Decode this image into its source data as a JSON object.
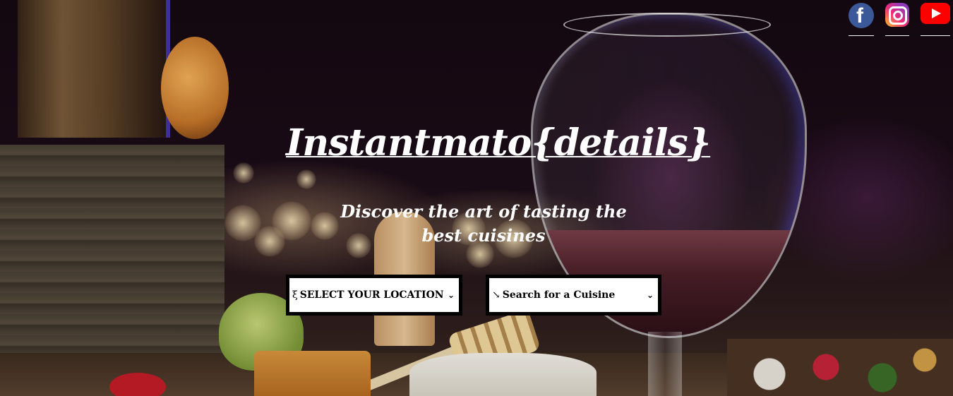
{
  "header": {
    "title": "Instantmato{details}",
    "tagline": "Discover the art of tasting the best cuisines"
  },
  "social": [
    {
      "name": "facebook-icon",
      "glyph": "f",
      "color": "#3b5998"
    },
    {
      "name": "instagram-icon",
      "color": "#e1306c"
    },
    {
      "name": "youtube-icon",
      "color": "#ff0000"
    }
  ],
  "search": {
    "location": {
      "icon": "location-pin-icon",
      "glyph": "ξ",
      "label": "SELECT YOUR LOCATION"
    },
    "cuisine": {
      "icon": "search-icon",
      "glyph": "↘",
      "label": "Search for a Cuisine"
    }
  },
  "colors": {
    "text": "#ffffff",
    "select_border": "#000000",
    "select_bg": "#ffffff"
  }
}
